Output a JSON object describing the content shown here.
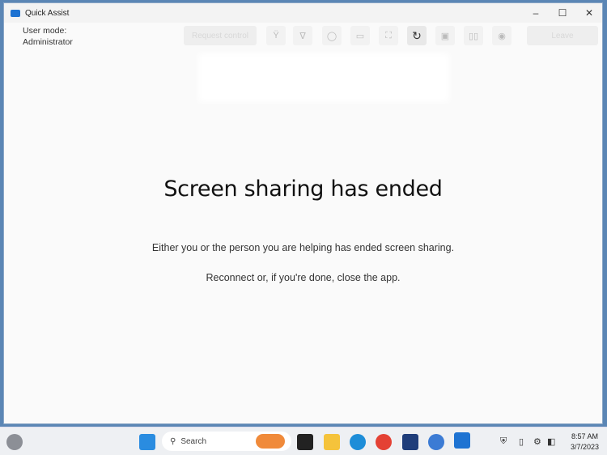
{
  "window": {
    "title": "Quick Assist",
    "minimize": "–",
    "maximize": "☐",
    "close": "✕"
  },
  "toolbar": {
    "user_mode_label": "User mode:",
    "user_mode_value": "Administrator",
    "request_control": "Request control",
    "leave": "Leave",
    "icons": [
      "laser-pointer-icon",
      "annotate-icon",
      "chat-icon",
      "monitor-icon",
      "fullscreen-icon",
      "restart-icon",
      "task-manager-icon",
      "pause-icon",
      "stop-icon"
    ]
  },
  "main": {
    "heading": "Screen sharing has ended",
    "line1": "Either you or the person you are helping has ended screen sharing.",
    "line2": "Reconnect or, if you're done, close the app."
  },
  "taskbar": {
    "search": "Search",
    "time": "8:57 AM",
    "date": "3/7/2023"
  }
}
